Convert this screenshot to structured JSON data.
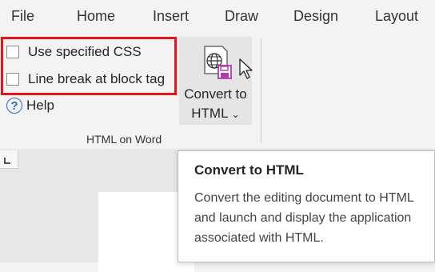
{
  "tabs": [
    "File",
    "Home",
    "Insert",
    "Draw",
    "Design",
    "Layout"
  ],
  "ribbon": {
    "options": [
      {
        "label": "Use specified CSS",
        "checked": false
      },
      {
        "label": "Line break at block tag",
        "checked": false
      }
    ],
    "help_label": "Help",
    "group_label": "HTML on Word",
    "convert_label_line1": "Convert to",
    "convert_label_line2": "HTML",
    "highlight_color": "#e8141c"
  },
  "tooltip": {
    "title": "Convert to HTML",
    "body": "Convert the editing document to HTML and launch and display the application associated with HTML."
  },
  "icons": {
    "convert": "globe-document-save-icon",
    "help": "help-circle-icon",
    "cursor": "mouse-pointer-icon"
  }
}
